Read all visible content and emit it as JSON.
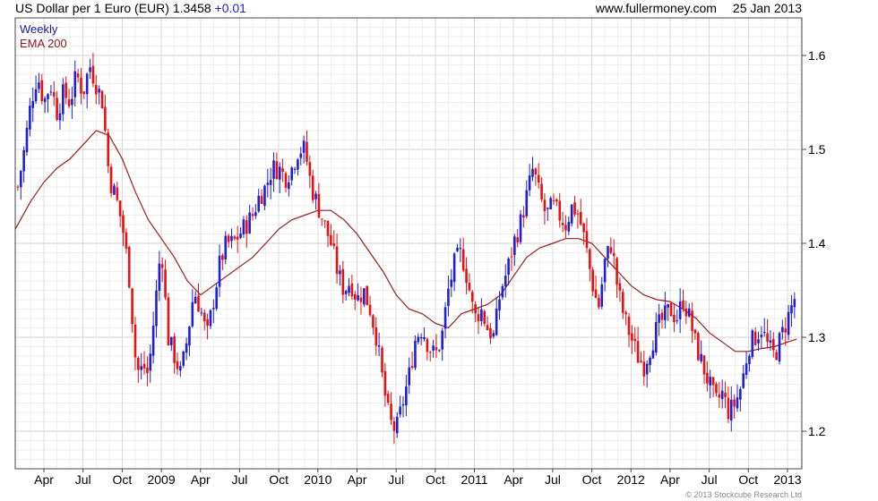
{
  "header": {
    "title": "US Dollar per 1 Euro (EUR)",
    "last": "1.3458",
    "change": "+0.01",
    "site": "www.fullermoney.com",
    "date": "25 Jan 2013"
  },
  "legend": [
    {
      "label": "Weekly",
      "color": "#1a1aa0"
    },
    {
      "label": "EMA 200",
      "color": "#8b1a1a"
    }
  ],
  "copyright": "© 2013 Stockcube Research Ltd",
  "colors": {
    "up": "#1f1fd6",
    "down": "#e81010",
    "ema": "#9b1d1d",
    "grid": "#dddddd"
  },
  "chart_data": {
    "type": "candlestick",
    "interval": "weekly",
    "y_ticks": [
      1.2,
      1.3,
      1.4,
      1.5,
      1.6
    ],
    "ylim": [
      1.16,
      1.64
    ],
    "x_ticks": [
      {
        "label": "Apr",
        "m": 3
      },
      {
        "label": "Jul",
        "m": 6
      },
      {
        "label": "Oct",
        "m": 9
      },
      {
        "label": "2009",
        "m": 12
      },
      {
        "label": "Apr",
        "m": 15
      },
      {
        "label": "Jul",
        "m": 18
      },
      {
        "label": "Oct",
        "m": 21
      },
      {
        "label": "2010",
        "m": 24
      },
      {
        "label": "Apr",
        "m": 27
      },
      {
        "label": "Jul",
        "m": 30
      },
      {
        "label": "Oct",
        "m": 33
      },
      {
        "label": "2011",
        "m": 36
      },
      {
        "label": "Apr",
        "m": 39
      },
      {
        "label": "Jul",
        "m": 42
      },
      {
        "label": "Oct",
        "m": 45
      },
      {
        "label": "2012",
        "m": 48
      },
      {
        "label": "Apr",
        "m": 51
      },
      {
        "label": "Jul",
        "m": 54
      },
      {
        "label": "Oct",
        "m": 57
      },
      {
        "label": "2013",
        "m": 60
      }
    ],
    "xlim": [
      0.8,
      61.1
    ],
    "close_path": [
      [
        1.0,
        1.46
      ],
      [
        1.5,
        1.5
      ],
      [
        2.0,
        1.55
      ],
      [
        2.5,
        1.58
      ],
      [
        3.0,
        1.55
      ],
      [
        3.5,
        1.57
      ],
      [
        4.0,
        1.54
      ],
      [
        4.5,
        1.56
      ],
      [
        5.0,
        1.55
      ],
      [
        5.5,
        1.58
      ],
      [
        6.0,
        1.56
      ],
      [
        6.5,
        1.59
      ],
      [
        7.0,
        1.57
      ],
      [
        7.5,
        1.55
      ],
      [
        8.0,
        1.47
      ],
      [
        8.5,
        1.45
      ],
      [
        9.0,
        1.42
      ],
      [
        9.5,
        1.37
      ],
      [
        10.0,
        1.28
      ],
      [
        10.3,
        1.26
      ],
      [
        10.6,
        1.27
      ],
      [
        11.0,
        1.26
      ],
      [
        11.5,
        1.33
      ],
      [
        12.0,
        1.4
      ],
      [
        12.5,
        1.3
      ],
      [
        13.0,
        1.28
      ],
      [
        13.5,
        1.26
      ],
      [
        14.0,
        1.3
      ],
      [
        14.5,
        1.35
      ],
      [
        15.0,
        1.33
      ],
      [
        15.5,
        1.3
      ],
      [
        16.0,
        1.34
      ],
      [
        16.5,
        1.38
      ],
      [
        17.0,
        1.4
      ],
      [
        17.5,
        1.4
      ],
      [
        18.0,
        1.41
      ],
      [
        18.5,
        1.42
      ],
      [
        19.0,
        1.43
      ],
      [
        19.5,
        1.45
      ],
      [
        20.0,
        1.46
      ],
      [
        20.5,
        1.48
      ],
      [
        21.0,
        1.48
      ],
      [
        21.5,
        1.47
      ],
      [
        22.0,
        1.48
      ],
      [
        22.5,
        1.5
      ],
      [
        23.0,
        1.5
      ],
      [
        23.5,
        1.46
      ],
      [
        24.0,
        1.44
      ],
      [
        24.5,
        1.42
      ],
      [
        25.0,
        1.4
      ],
      [
        25.5,
        1.37
      ],
      [
        26.0,
        1.35
      ],
      [
        26.5,
        1.36
      ],
      [
        27.0,
        1.34
      ],
      [
        27.5,
        1.35
      ],
      [
        28.0,
        1.33
      ],
      [
        28.5,
        1.3
      ],
      [
        29.0,
        1.25
      ],
      [
        29.5,
        1.21
      ],
      [
        30.0,
        1.2
      ],
      [
        30.5,
        1.23
      ],
      [
        31.0,
        1.26
      ],
      [
        31.5,
        1.3
      ],
      [
        32.0,
        1.31
      ],
      [
        32.5,
        1.29
      ],
      [
        33.0,
        1.28
      ],
      [
        33.5,
        1.3
      ],
      [
        34.0,
        1.35
      ],
      [
        34.5,
        1.38
      ],
      [
        35.0,
        1.39
      ],
      [
        35.5,
        1.36
      ],
      [
        36.0,
        1.32
      ],
      [
        36.5,
        1.33
      ],
      [
        37.0,
        1.31
      ],
      [
        37.5,
        1.3
      ],
      [
        38.0,
        1.35
      ],
      [
        38.5,
        1.37
      ],
      [
        39.0,
        1.4
      ],
      [
        39.5,
        1.42
      ],
      [
        40.0,
        1.45
      ],
      [
        40.5,
        1.48
      ],
      [
        41.0,
        1.45
      ],
      [
        41.5,
        1.43
      ],
      [
        42.0,
        1.44
      ],
      [
        42.5,
        1.43
      ],
      [
        43.0,
        1.42
      ],
      [
        43.5,
        1.44
      ],
      [
        44.0,
        1.43
      ],
      [
        44.5,
        1.4
      ],
      [
        45.0,
        1.36
      ],
      [
        45.5,
        1.33
      ],
      [
        46.0,
        1.38
      ],
      [
        46.5,
        1.4
      ],
      [
        47.0,
        1.35
      ],
      [
        47.5,
        1.32
      ],
      [
        48.0,
        1.3
      ],
      [
        48.5,
        1.28
      ],
      [
        49.0,
        1.27
      ],
      [
        49.5,
        1.29
      ],
      [
        50.0,
        1.31
      ],
      [
        50.5,
        1.32
      ],
      [
        51.0,
        1.33
      ],
      [
        51.5,
        1.32
      ],
      [
        52.0,
        1.34
      ],
      [
        52.5,
        1.32
      ],
      [
        53.0,
        1.29
      ],
      [
        53.5,
        1.27
      ],
      [
        54.0,
        1.25
      ],
      [
        54.5,
        1.23
      ],
      [
        55.0,
        1.24
      ],
      [
        55.5,
        1.22
      ],
      [
        56.0,
        1.23
      ],
      [
        56.5,
        1.25
      ],
      [
        57.0,
        1.29
      ],
      [
        57.5,
        1.3
      ],
      [
        58.0,
        1.31
      ],
      [
        58.5,
        1.29
      ],
      [
        59.0,
        1.28
      ],
      [
        59.5,
        1.3
      ],
      [
        60.0,
        1.32
      ],
      [
        60.5,
        1.34
      ],
      [
        60.7,
        1.3458
      ]
    ],
    "ema200": [
      [
        0.8,
        1.415
      ],
      [
        2.0,
        1.445
      ],
      [
        3.0,
        1.465
      ],
      [
        4.0,
        1.48
      ],
      [
        5.0,
        1.49
      ],
      [
        6.0,
        1.505
      ],
      [
        7.0,
        1.52
      ],
      [
        8.0,
        1.515
      ],
      [
        9.0,
        1.49
      ],
      [
        10.0,
        1.455
      ],
      [
        11.0,
        1.425
      ],
      [
        12.0,
        1.405
      ],
      [
        13.0,
        1.385
      ],
      [
        14.0,
        1.36
      ],
      [
        15.0,
        1.345
      ],
      [
        16.0,
        1.355
      ],
      [
        17.0,
        1.365
      ],
      [
        18.0,
        1.375
      ],
      [
        19.0,
        1.385
      ],
      [
        20.0,
        1.4
      ],
      [
        21.0,
        1.415
      ],
      [
        22.0,
        1.425
      ],
      [
        23.0,
        1.43
      ],
      [
        24.0,
        1.435
      ],
      [
        25.0,
        1.435
      ],
      [
        26.0,
        1.425
      ],
      [
        27.0,
        1.41
      ],
      [
        28.0,
        1.39
      ],
      [
        29.0,
        1.37
      ],
      [
        30.0,
        1.345
      ],
      [
        31.0,
        1.33
      ],
      [
        32.0,
        1.325
      ],
      [
        33.0,
        1.315
      ],
      [
        34.0,
        1.31
      ],
      [
        35.0,
        1.325
      ],
      [
        36.0,
        1.33
      ],
      [
        37.0,
        1.335
      ],
      [
        38.0,
        1.345
      ],
      [
        39.0,
        1.365
      ],
      [
        40.0,
        1.385
      ],
      [
        41.0,
        1.395
      ],
      [
        42.0,
        1.4
      ],
      [
        43.0,
        1.405
      ],
      [
        44.0,
        1.405
      ],
      [
        45.0,
        1.4
      ],
      [
        46.0,
        1.385
      ],
      [
        47.0,
        1.37
      ],
      [
        48.0,
        1.355
      ],
      [
        49.0,
        1.345
      ],
      [
        50.0,
        1.34
      ],
      [
        51.0,
        1.338
      ],
      [
        52.0,
        1.33
      ],
      [
        53.0,
        1.32
      ],
      [
        54.0,
        1.305
      ],
      [
        55.0,
        1.295
      ],
      [
        56.0,
        1.285
      ],
      [
        57.0,
        1.285
      ],
      [
        58.0,
        1.288
      ],
      [
        59.0,
        1.29
      ],
      [
        60.0,
        1.295
      ],
      [
        60.7,
        1.298
      ]
    ],
    "volatility": 0.017
  }
}
